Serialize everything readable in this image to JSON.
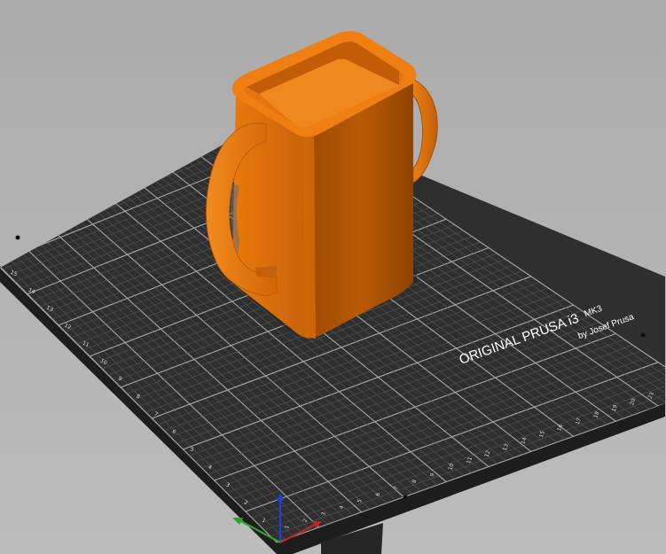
{
  "window": {
    "view": "3D plater view"
  },
  "bed": {
    "brand_line": "ORIGINAL PRUSA i3",
    "model": "MK3",
    "maker": "by Josef Prusa",
    "surface_color": "#2f2f2f",
    "grid_minor_color": "#565656",
    "grid_major_color": "#a8a8a8",
    "edge_ticks": [
      "1",
      "2",
      "3",
      "4",
      "5",
      "6",
      "7",
      "8",
      "9",
      "10",
      "11",
      "12",
      "13",
      "14",
      "15",
      "16",
      "17",
      "18",
      "19",
      "20",
      "21",
      "22"
    ],
    "side_ticks": [
      "1",
      "2",
      "3",
      "4",
      "5",
      "6",
      "7",
      "8",
      "9",
      "10",
      "11",
      "12",
      "13",
      "14",
      "15",
      "16"
    ]
  },
  "object": {
    "type": "mug with handles",
    "color": "#e06e0a"
  },
  "axes": {
    "x_label": "X",
    "x_color": "#c0242a",
    "y_label": "Y",
    "y_color": "#2fa22f",
    "z_label": "Z",
    "z_color": "#1f3fd9"
  }
}
